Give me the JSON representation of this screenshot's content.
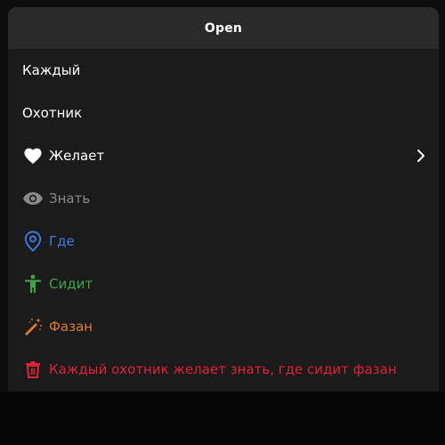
{
  "header": {
    "open_label": "Open"
  },
  "menu": {
    "items": [
      {
        "label": "Каждый",
        "icon": null,
        "color": "#ffffff"
      },
      {
        "label": "Охотник",
        "icon": null,
        "color": "#ffffff"
      },
      {
        "label": "Желает",
        "icon": "heart-icon",
        "color": "#ffffff",
        "has_submenu": true
      },
      {
        "label": "Знать",
        "icon": "eye-icon",
        "color": "#8a8a8a",
        "disabled": true
      },
      {
        "label": "Где",
        "icon": "location-pin-icon",
        "color": "#3b7be0"
      },
      {
        "label": "Сидит",
        "icon": "accessibility-icon",
        "color": "#3fa34a"
      },
      {
        "label": "Фазан",
        "icon": "magic-wand-icon",
        "color": "#e07a2c"
      },
      {
        "label": "Каждый охотник желает знать, где сидит фазан",
        "icon": "trash-icon",
        "color": "#e0213a"
      }
    ]
  },
  "colors": {
    "background": "#0d0d0d",
    "header_bg": "#2a2a2a",
    "menu_bg": "#1b1b1b",
    "white": "#ffffff",
    "gray": "#8a8a8a",
    "blue": "#3b7be0",
    "green": "#3fa34a",
    "orange": "#e07a2c",
    "red": "#e0213a"
  }
}
